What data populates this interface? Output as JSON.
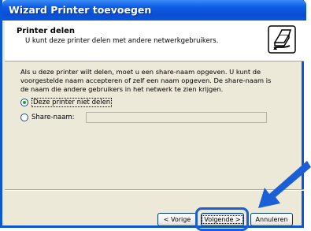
{
  "window": {
    "title": "Wizard Printer toevoegen"
  },
  "header": {
    "title": "Printer delen",
    "subtitle": "U kunt deze printer delen met andere netwerkgebruikers."
  },
  "body": {
    "description": "Als u deze printer wilt delen, moet u een share-naam opgeven. U kunt de voorgestelde naam accepteren of zelf een naam opgeven. De share-naam is de naam die andere gebruikers in het netwerk te zien krijgen."
  },
  "options": {
    "no_share_label": "Deze printer niet delen",
    "share_label": "Share-naam:",
    "share_name_value": "",
    "selected": "no_share"
  },
  "buttons": {
    "back_label": "< Vorige",
    "next_label": "Volgende >",
    "cancel_label": "Annuleren"
  },
  "icons": {
    "printer": "printer-share-icon",
    "arrow": "pointer-arrow-icon"
  },
  "colors": {
    "titlebar": "#0a4fd2",
    "highlight": "#1b5fd6",
    "arrow": "#1b5fd6",
    "dialog_bg": "#ece9d8"
  }
}
